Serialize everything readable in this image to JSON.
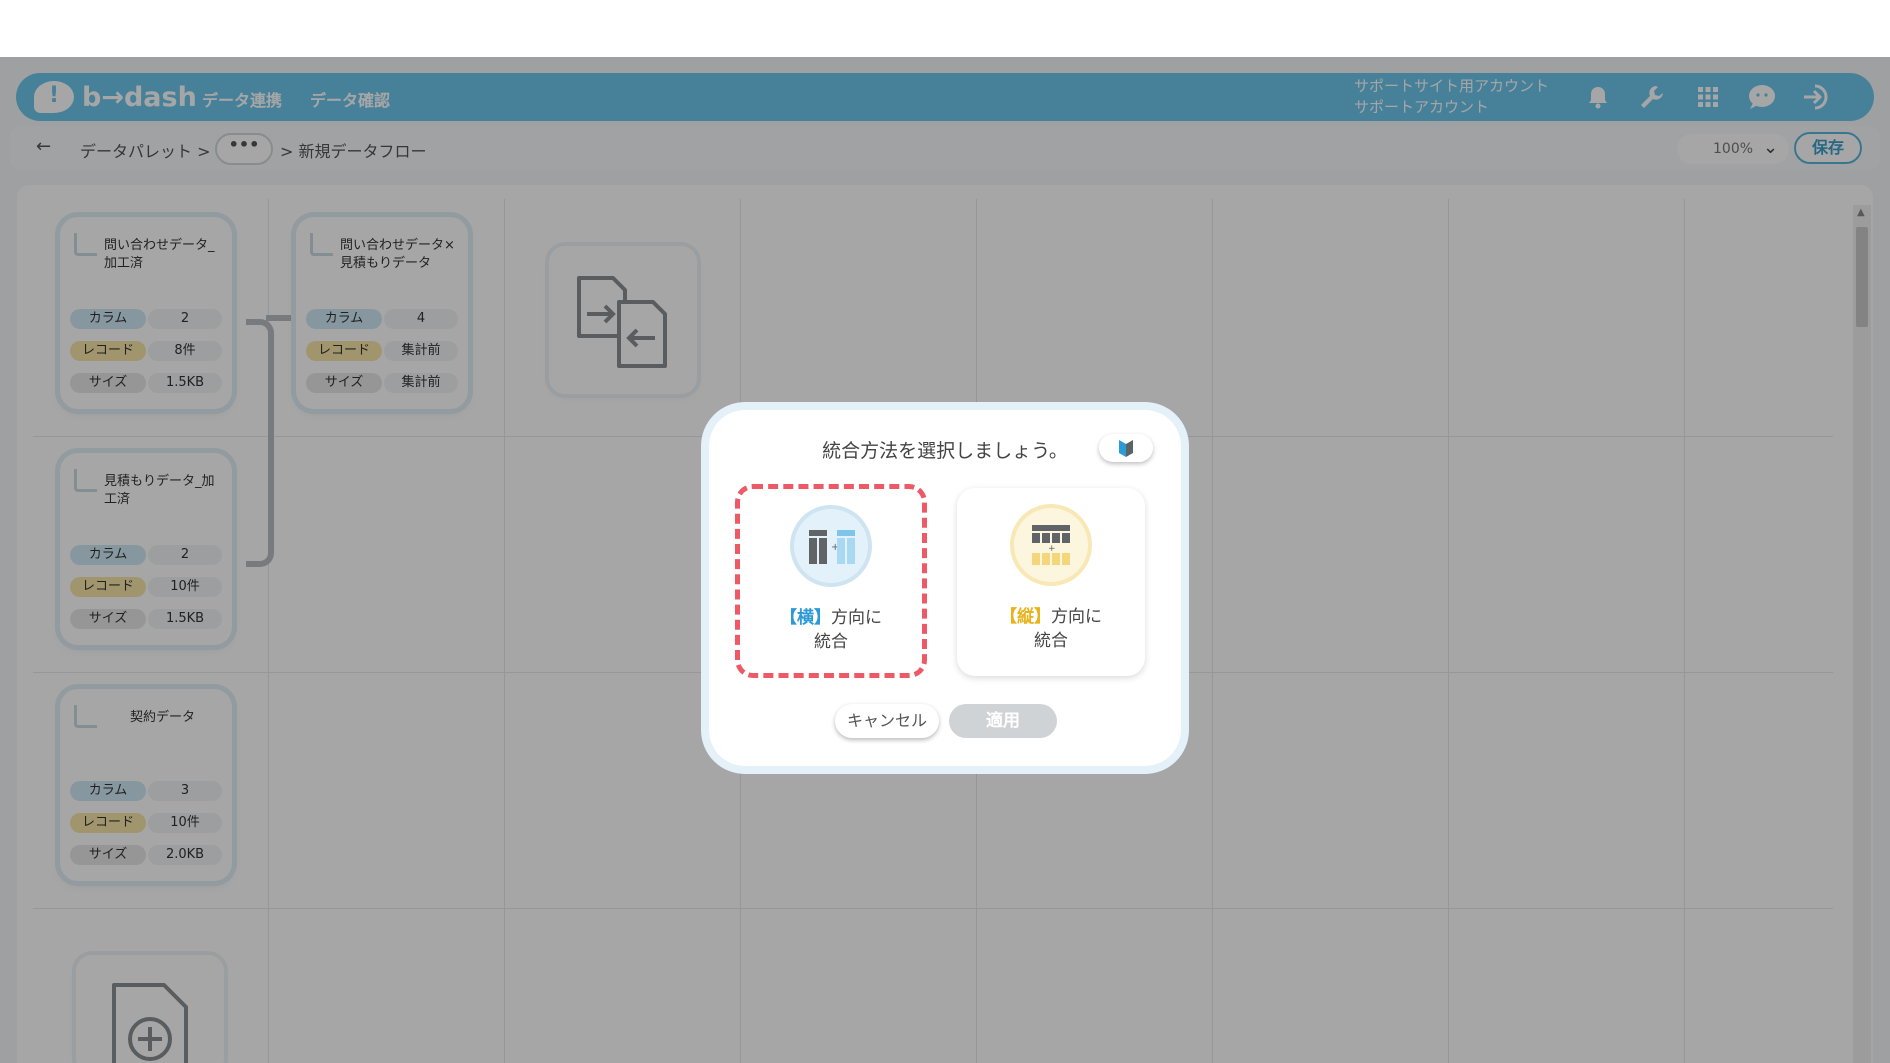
{
  "header": {
    "logo_text": "b→dash",
    "nav": [
      "データ連携",
      "データ確認"
    ],
    "account_line1": "サポートサイト用アカウント",
    "account_line2": "サポートアカウント",
    "icons": [
      "bell-icon",
      "wrench-icon",
      "grid-icon",
      "support-chat-icon",
      "logout-icon"
    ],
    "accent_color": "#6ec7eb"
  },
  "breadcrumb": {
    "back": "←",
    "root": "データパレット >",
    "more": "•••",
    "current": "> 新規データフロー"
  },
  "toolbar": {
    "zoom": "100%",
    "save": "保存"
  },
  "stat_labels": {
    "columns": "カラム",
    "records": "レコード",
    "size": "サイズ"
  },
  "cards": [
    {
      "title": "問い合わせデータ_加工済",
      "columns": "2",
      "records": "8件",
      "size": "1.5KB"
    },
    {
      "title": "見積もりデータ_加工済",
      "columns": "2",
      "records": "10件",
      "size": "1.5KB"
    },
    {
      "title": "契約データ",
      "columns": "3",
      "records": "10件",
      "size": "2.0KB"
    },
    {
      "title": "問い合わせデータ×見積もりデータ",
      "columns": "4",
      "records": "集計前",
      "size": "集計前"
    }
  ],
  "modal": {
    "title": "統合方法を選択しましょう。",
    "option_horizontal": {
      "bracket": "【横】",
      "line1": "方向に",
      "line2": "統合"
    },
    "option_vertical": {
      "bracket": "【縦】",
      "line1": "方向に",
      "line2": "統合"
    },
    "cancel": "キャンセル",
    "apply": "適用",
    "selected": "horizontal"
  },
  "colors": {
    "selected_border": "#ee5966",
    "horizontal_accent": "#2c9ad6",
    "vertical_accent": "#e9b31b"
  }
}
